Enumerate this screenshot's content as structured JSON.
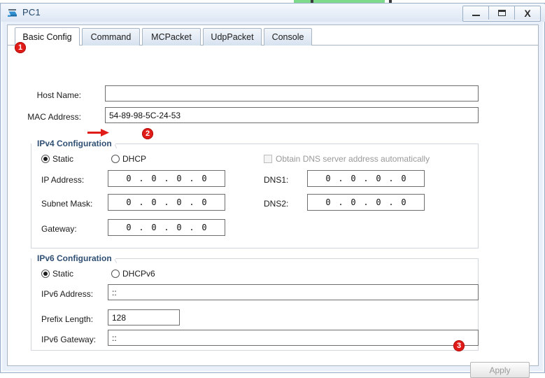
{
  "window": {
    "title": "PC1",
    "icon": "pc-device-icon",
    "buttons": {
      "minimize": "–",
      "maximize": "▭",
      "close": "X"
    }
  },
  "tabs": [
    {
      "label": "Basic Config",
      "active": true
    },
    {
      "label": "Command",
      "active": false
    },
    {
      "label": "MCPacket",
      "active": false
    },
    {
      "label": "UdpPacket",
      "active": false
    },
    {
      "label": "Console",
      "active": false
    }
  ],
  "basic": {
    "host_name_label": "Host Name:",
    "host_name_value": "",
    "mac_label": "MAC Address:",
    "mac_value": "54-89-98-5C-24-53"
  },
  "ipv4": {
    "group_title": "IPv4 Configuration",
    "static_label": "Static",
    "static_checked": true,
    "dhcp_label": "DHCP",
    "dhcp_checked": false,
    "obtain_dns_label": "Obtain DNS server address automatically",
    "obtain_dns_checked": false,
    "obtain_dns_disabled": true,
    "ip_label": "IP Address:",
    "ip_octets": [
      "0",
      "0",
      "0",
      "0"
    ],
    "mask_label": "Subnet Mask:",
    "mask_octets": [
      "0",
      "0",
      "0",
      "0"
    ],
    "gateway_label": "Gateway:",
    "gateway_octets": [
      "0",
      "0",
      "0",
      "0"
    ],
    "dns1_label": "DNS1:",
    "dns1_octets": [
      "0",
      "0",
      "0",
      "0"
    ],
    "dns2_label": "DNS2:",
    "dns2_octets": [
      "0",
      "0",
      "0",
      "0"
    ]
  },
  "ipv6": {
    "group_title": "IPv6 Configuration",
    "static_label": "Static",
    "static_checked": true,
    "dhcpv6_label": "DHCPv6",
    "dhcpv6_checked": false,
    "address_label": "IPv6 Address:",
    "address_value": "::",
    "prefix_label": "Prefix Length:",
    "prefix_value": "128",
    "gateway_label": "IPv6 Gateway:",
    "gateway_value": "::"
  },
  "actions": {
    "apply_label": "Apply",
    "apply_disabled": true
  },
  "annotations": {
    "badge1": "1",
    "badge2": "2",
    "badge3": "3",
    "arrow_color": "#e01b18",
    "badge_color": "#e01b18"
  }
}
